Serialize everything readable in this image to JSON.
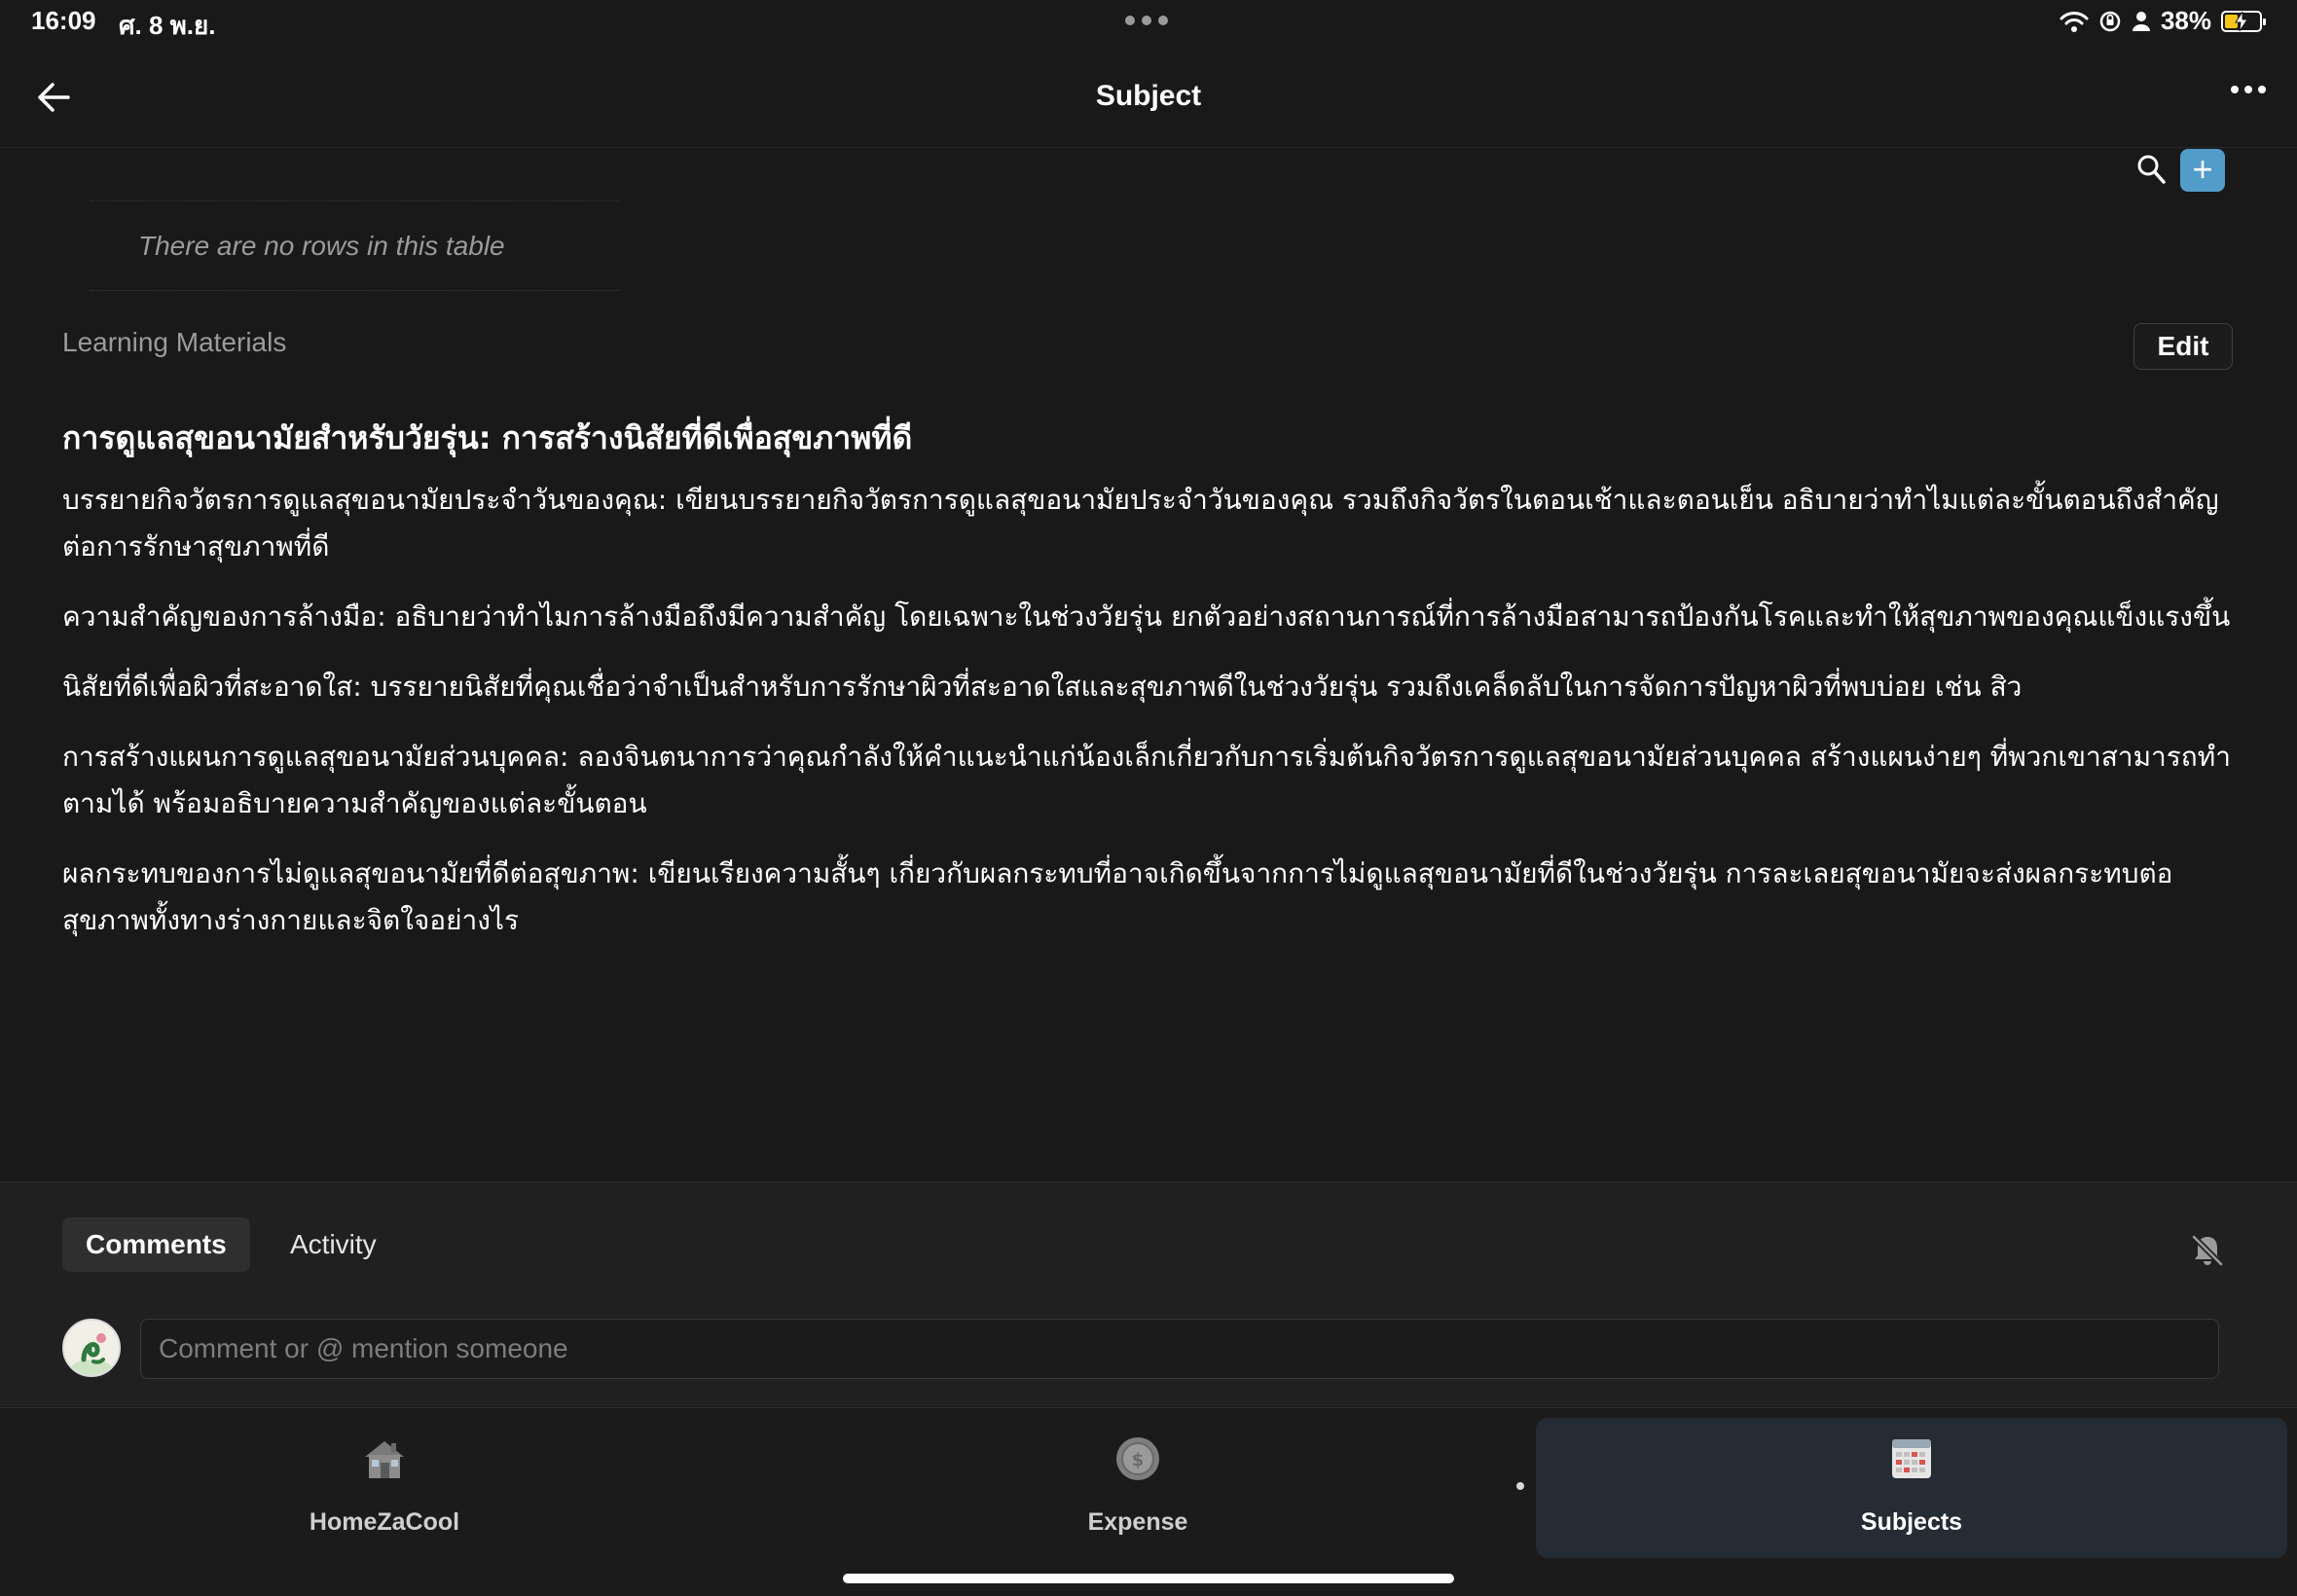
{
  "status_bar": {
    "time": "16:09",
    "date": "ศ. 8 พ.ย.",
    "battery": "38%",
    "battery_level": 0.38,
    "icons": [
      "wifi-icon",
      "orientation-lock-icon",
      "person-icon",
      "battery-charging-icon"
    ]
  },
  "header": {
    "title": "Subject",
    "back_icon": "arrow-left-icon",
    "more_icon": "ellipsis-icon"
  },
  "table": {
    "empty_text": "There are no rows in this table",
    "add_label": "+"
  },
  "learning_materials": {
    "label": "Learning Materials",
    "edit_label": "Edit",
    "heading": "การดูแลสุขอนามัยสำหรับวัยรุ่น: การสร้างนิสัยที่ดีเพื่อสุขภาพที่ดี",
    "paragraphs": [
      "บรรยายกิจวัตรการดูแลสุขอนามัยประจำวันของคุณ: เขียนบรรยายกิจวัตรการดูแลสุขอนามัยประจำวันของคุณ รวมถึงกิจวัตรในตอนเช้าและตอนเย็น อธิบายว่าทำไมแต่ละขั้นตอนถึงสำคัญต่อการรักษาสุขภาพที่ดี",
      "ความสำคัญของการล้างมือ: อธิบายว่าทำไมการล้างมือถึงมีความสำคัญ โดยเฉพาะในช่วงวัยรุ่น ยกตัวอย่างสถานการณ์ที่การล้างมือสามารถป้องกันโรคและทำให้สุขภาพของคุณแข็งแรงขึ้น",
      "นิสัยที่ดีเพื่อผิวที่สะอาดใส: บรรยายนิสัยที่คุณเชื่อว่าจำเป็นสำหรับการรักษาผิวที่สะอาดใสและสุขภาพดีในช่วงวัยรุ่น รวมถึงเคล็ดลับในการจัดการปัญหาผิวที่พบบ่อย เช่น สิว",
      "การสร้างแผนการดูแลสุขอนามัยส่วนบุคคล: ลองจินตนาการว่าคุณกำลังให้คำแนะนำแก่น้องเล็กเกี่ยวกับการเริ่มต้นกิจวัตรการดูแลสุขอนามัยส่วนบุคคล สร้างแผนง่ายๆ ที่พวกเขาสามารถทำตามได้ พร้อมอธิบายความสำคัญของแต่ละขั้นตอน",
      "ผลกระทบของการไม่ดูแลสุขอนามัยที่ดีต่อสุขภาพ: เขียนเรียงความสั้นๆ เกี่ยวกับผลกระทบที่อาจเกิดขึ้นจากการไม่ดูแลสุขอนามัยที่ดีในช่วงวัยรุ่น การละเลยสุขอนามัยจะส่งผลกระทบต่อสุขภาพทั้งทางร่างกายและจิตใจอย่างไร"
    ]
  },
  "comments": {
    "tabs": [
      "Comments",
      "Activity"
    ],
    "active_tab": "Comments",
    "placeholder": "Comment or @ mention someone",
    "notification_icon": "bell-off-icon"
  },
  "bottom_nav": {
    "items": [
      {
        "label": "HomeZaCool",
        "icon": "house-icon"
      },
      {
        "label": "Expense",
        "icon": "coin-icon"
      },
      {
        "label": "Subjects",
        "icon": "grid-calendar-icon"
      }
    ],
    "active": "Subjects"
  },
  "colors": {
    "background": "#191919",
    "accent": "#529cca",
    "muted_text": "#9b9b9b",
    "battery_charging": "#f5c518"
  }
}
